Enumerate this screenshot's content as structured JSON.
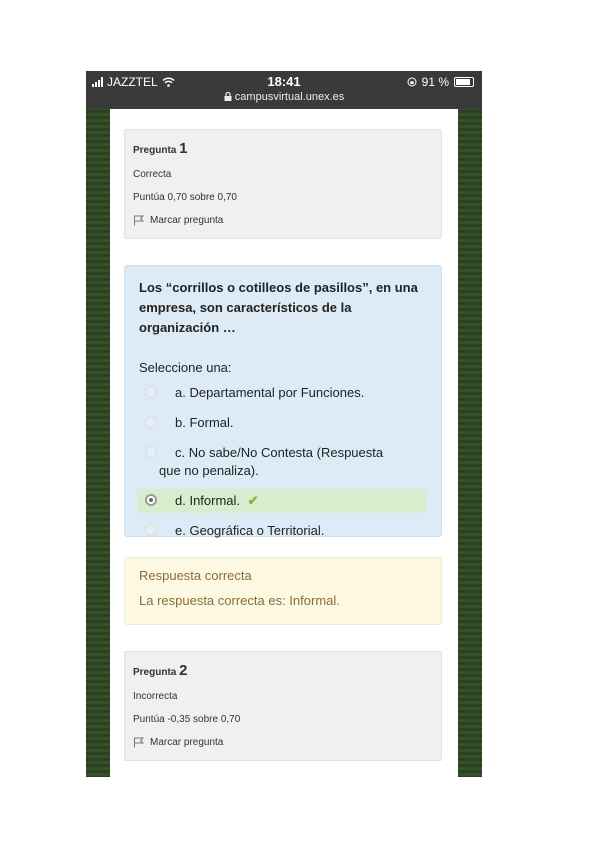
{
  "status_bar": {
    "carrier": "JAZZTEL",
    "time": "18:41",
    "url": "campusvirtual.unex.es",
    "battery": "91 %"
  },
  "question1": {
    "label": "Pregunta",
    "number": "1",
    "state": "Correcta",
    "grade": "Puntúa 0,70 sobre 0,70",
    "flag_label": "Marcar pregunta"
  },
  "formulation": {
    "question_text": "Los “corrillos o cotilleos de pasillos”, en una empresa, son característicos de la organización …",
    "prompt": "Seleccione una:",
    "options": [
      {
        "label": "a. Departamental por Funciones.",
        "selected": false
      },
      {
        "label": "b. Formal.",
        "selected": false
      },
      {
        "label": "c. No sabe/No Contesta (Respuesta",
        "label_cont": "que no penaliza).",
        "selected": false
      },
      {
        "label": "d. Informal.",
        "selected": true
      },
      {
        "label": "e. Geográfica o Territorial.",
        "selected": false
      }
    ]
  },
  "feedback": {
    "result": "Respuesta correcta",
    "right_answer": "La respuesta correcta es: Informal."
  },
  "question2": {
    "label": "Pregunta",
    "number": "2",
    "state": "Incorrecta",
    "grade": "Puntúa -0,35 sobre 0,70",
    "flag_label": "Marcar pregunta"
  },
  "colors": {
    "formulation_bg": "#dcebf6",
    "selected_bg": "#d8ecce",
    "feedback_bg": "#fcf8e1",
    "check": "#7bbb2c"
  }
}
